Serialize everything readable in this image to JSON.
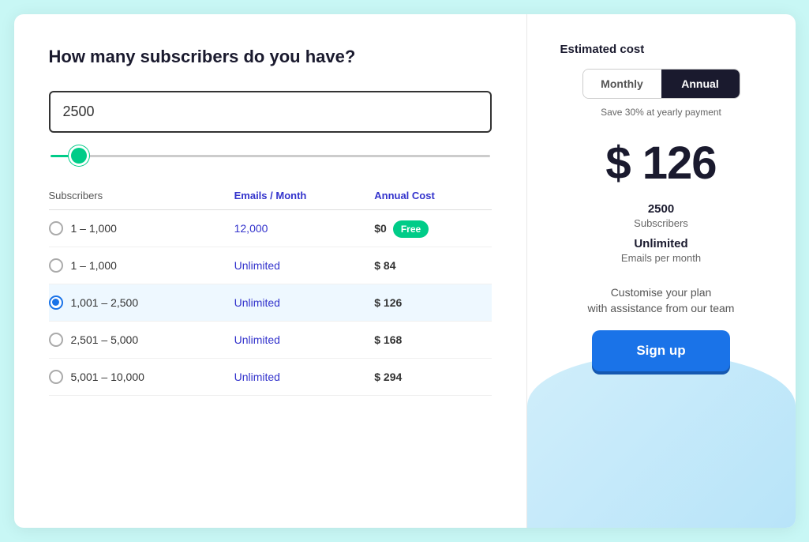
{
  "left": {
    "question": "How many subscribers do you have?",
    "input_value": "2500",
    "slider_value": 5,
    "table": {
      "headers": [
        "Subscribers",
        "Emails / Month",
        "Annual Cost"
      ],
      "rows": [
        {
          "id": "row-1",
          "range": "1 – 1,000",
          "emails": "12,000",
          "cost": "$0",
          "free_badge": "Free",
          "selected": false
        },
        {
          "id": "row-2",
          "range": "1 – 1,000",
          "emails": "Unlimited",
          "cost": "$ 84",
          "free_badge": null,
          "selected": false
        },
        {
          "id": "row-3",
          "range": "1,001 – 2,500",
          "emails": "Unlimited",
          "cost": "$ 126",
          "free_badge": null,
          "selected": true
        },
        {
          "id": "row-4",
          "range": "2,501 – 5,000",
          "emails": "Unlimited",
          "cost": "$ 168",
          "free_badge": null,
          "selected": false
        },
        {
          "id": "row-5",
          "range": "5,001 – 10,000",
          "emails": "Unlimited",
          "cost": "$ 294",
          "free_badge": null,
          "selected": false
        }
      ]
    }
  },
  "right": {
    "estimated_label": "Estimated cost",
    "toggle": {
      "monthly": "Monthly",
      "annual": "Annual",
      "active": "Annual"
    },
    "save_text": "Save 30% at yearly payment",
    "price": "$ 126",
    "subscribers_count": "2500",
    "subscribers_label": "Subscribers",
    "unlimited_label": "Unlimited",
    "emails_label": "Emails per month",
    "customise_line1": "Customise your plan",
    "customise_line2": "with assistance from our team",
    "signup_btn": "Sign up"
  },
  "colors": {
    "accent_green": "#00cc88",
    "accent_blue": "#1a73e8",
    "dark": "#1a1a2e",
    "selected_radio": "#1a73e8"
  }
}
